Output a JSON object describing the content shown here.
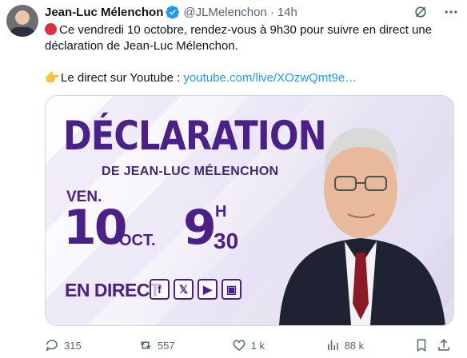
{
  "author": {
    "name": "Jean-Luc Mélenchon",
    "handle": "@JLMelenchon",
    "separator": "·",
    "time": "14h"
  },
  "tweet": {
    "line1": "Ce vendredi 10 octobre, rendez-vous à 9h30 pour suivre en direct une déclaration de Jean-Luc Mélenchon.",
    "line2_prefix": "Le direct sur Youtube :",
    "link": "youtube.com/live/XOzwQmt9e…"
  },
  "media": {
    "title": "DÉCLARATION",
    "subtitle": "DE JEAN-LUC MÉLENCHON",
    "day": "VEN.",
    "date_number": "10",
    "month": "OCT.",
    "hour": "9",
    "hour_letter": "H",
    "minutes": "30",
    "live_label": "EN DIRECT",
    "socials": [
      "f",
      "𝕏",
      "▶",
      "▣"
    ]
  },
  "actions": {
    "replies": "315",
    "reposts": "557",
    "likes": "1 k",
    "views": "88 k"
  },
  "colors": {
    "brand_purple": "#4b2088",
    "link_blue": "#1d9bf0",
    "verified_blue": "#1d9bf0",
    "muted": "#536471"
  },
  "icons": {
    "verified": "verified-badge-icon",
    "grok": "grok-icon",
    "more": "more-icon",
    "reply": "reply-icon",
    "repost": "repost-icon",
    "like": "heart-icon",
    "views": "views-icon",
    "bookmark": "bookmark-icon",
    "share": "share-icon"
  }
}
